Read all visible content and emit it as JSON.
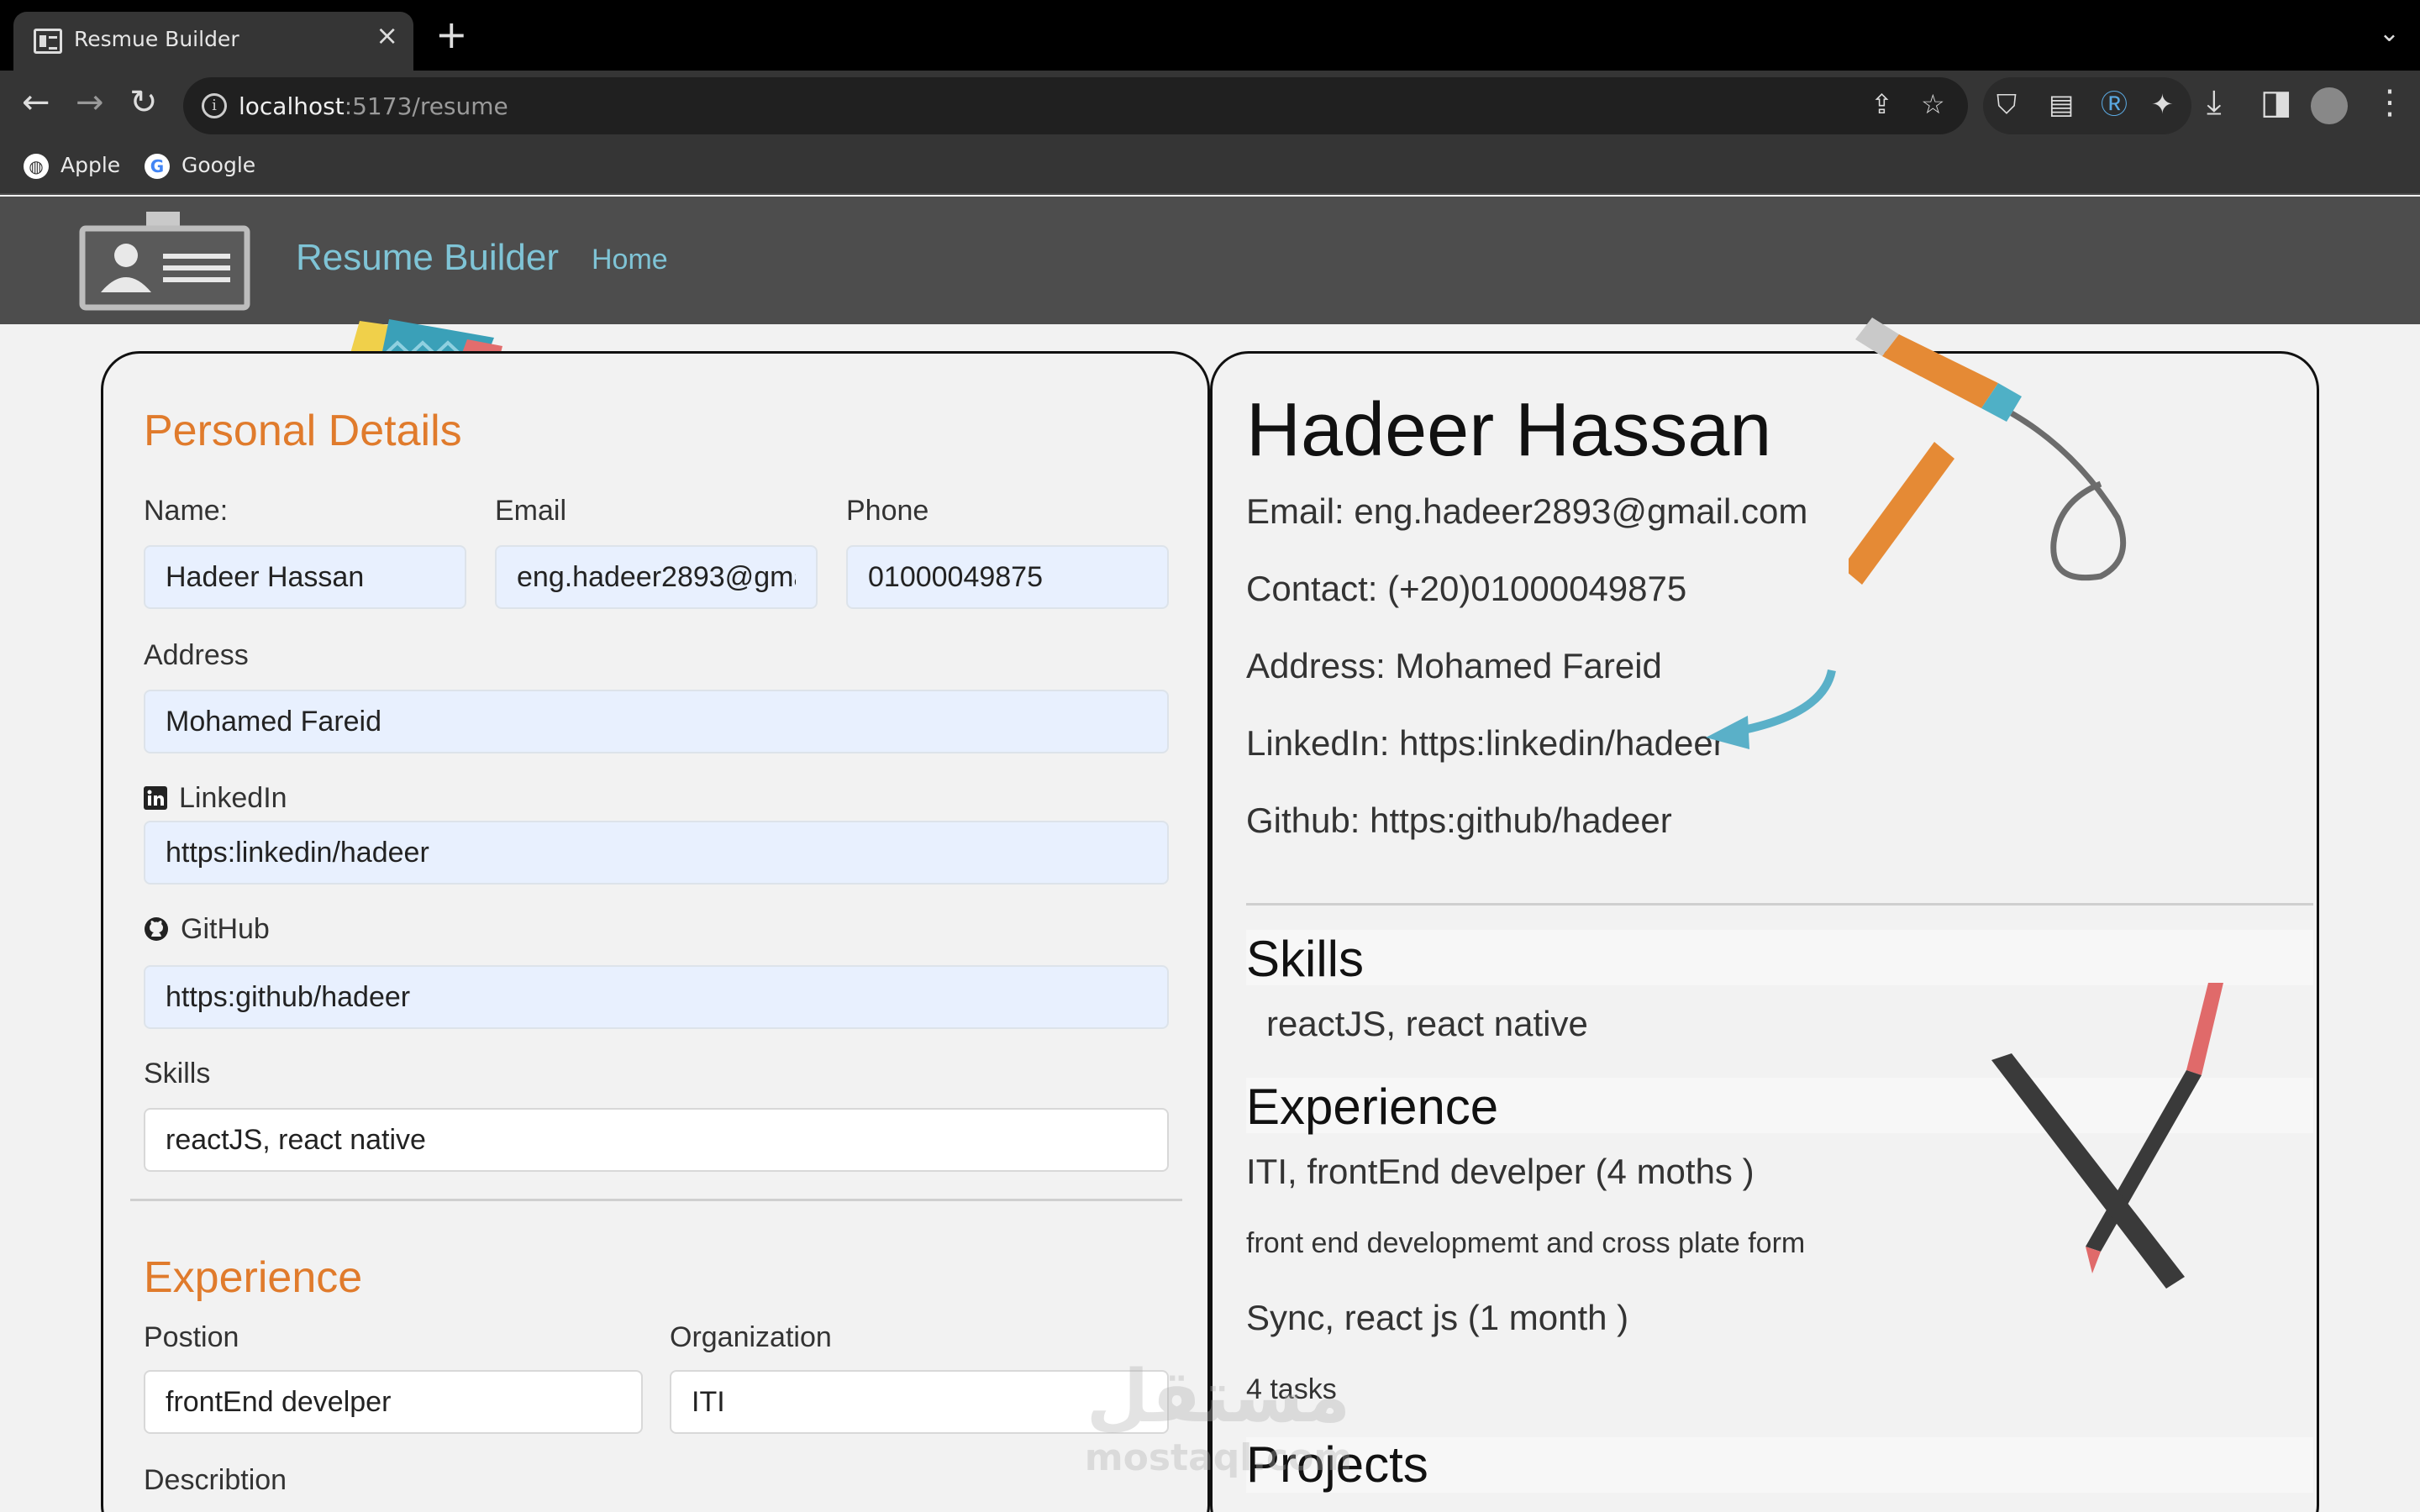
{
  "browser": {
    "tab_title": "Resmue Builder",
    "url_host": "localhost",
    "url_path": ":5173/resume",
    "bookmarks": [
      {
        "label": "Apple",
        "icon": "apple-globe-icon"
      },
      {
        "label": "Google",
        "icon": "google-icon"
      }
    ]
  },
  "navbar": {
    "brand": "Resume Builder",
    "home": "Home",
    "logo_icon": "id-card-icon"
  },
  "editor": {
    "personal_title": "Personal Details",
    "name_label": "Name:",
    "name_value": "Hadeer Hassan",
    "email_label": "Email",
    "email_value": "eng.hadeer2893@gmail.com",
    "phone_label": "Phone",
    "phone_value": "01000049875",
    "address_label": "Address",
    "address_value": "Mohamed Fareid",
    "linkedin_label": "LinkedIn",
    "linkedin_value": "https:linkedin/hadeer",
    "github_label": "GitHub",
    "github_value": "https:github/hadeer",
    "skills_label": "Skills",
    "skills_value": "reactJS, react native",
    "experience_title": "Experience",
    "position_label": "Postion",
    "position_value": "frontEnd develper",
    "organization_label": "Organization",
    "organization_value": "ITI",
    "description_label": "Describtion"
  },
  "preview": {
    "name": "Hadeer Hassan",
    "email": "Email: eng.hadeer2893@gmail.com",
    "contact": "Contact: (+20)01000049875",
    "address": "Address: Mohamed Fareid",
    "linkedin": "LinkedIn: https:linkedin/hadeer",
    "github": "Github: https:github/hadeer",
    "skills_heading": "Skills",
    "skills_text": "reactJS, react native",
    "experience_heading": "Experience",
    "exp1_title": "ITI, frontEnd develper (4 moths )",
    "exp1_desc": "front end developmemt and cross plate form",
    "exp2_title": "Sync, react js (1 month )",
    "exp2_desc": "4 tasks",
    "projects_heading": "Projects"
  },
  "colors": {
    "accent_orange": "#e07b2c",
    "brand_teal": "#7fc4d6",
    "navbar_bg": "#4d4d4d",
    "input_bg": "#e8f0fe"
  }
}
